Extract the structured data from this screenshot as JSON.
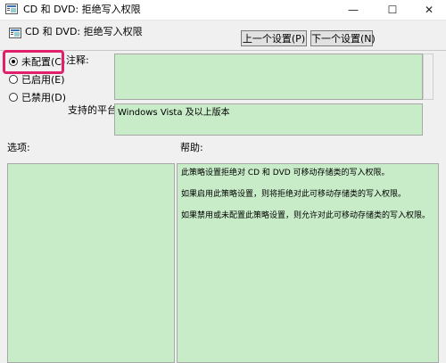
{
  "window": {
    "title": "CD 和 DVD: 拒绝写入权限",
    "minimize_glyph": "—",
    "maximize_glyph": "☐",
    "close_glyph": "✕"
  },
  "header": {
    "subtitle": "CD 和 DVD: 拒绝写入权限",
    "prev_button": "上一个设置(P)",
    "next_button": "下一个设置(N)"
  },
  "radios": [
    {
      "label": "未配置(C)",
      "selected": true
    },
    {
      "label": "已启用(E)",
      "selected": false
    },
    {
      "label": "已禁用(D)",
      "selected": false
    }
  ],
  "fields": {
    "comment_label": "注释:",
    "platform_label": "支持的平台:",
    "platform_value": "Windows Vista 及以上版本"
  },
  "sections": {
    "options_label": "选项:",
    "help_label": "帮助:"
  },
  "help": {
    "paragraphs": [
      "此策略设置拒绝对 CD 和 DVD 可移动存储类的写入权限。",
      "如果启用此策略设置，则将拒绝对此可移动存储类的写入权限。",
      "如果禁用或未配置此策略设置，则允许对此可移动存储类的写入权限。"
    ]
  },
  "colors": {
    "highlight": "#e0206a",
    "pane_green": "#c8ecc8"
  }
}
